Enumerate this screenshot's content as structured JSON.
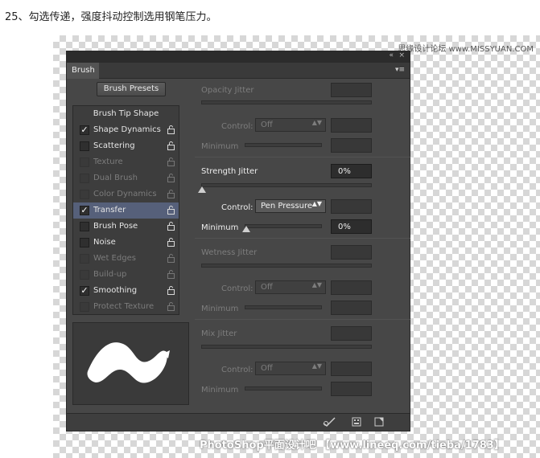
{
  "caption": "25、勾选传递，强度抖动控制选用钢笔压力。",
  "watermark_top": "思缘设计论坛 www.MISSYUAN.COM",
  "watermark_bottom": "PhotoShop平面设计吧 【www.lineeq.com/tieba/1783】",
  "panel": {
    "title_tab": "Brush",
    "collapse_icon": "«",
    "close_icon": "×",
    "menu_icon": "▾≡",
    "presets_button": "Brush Presets",
    "list_header": "Brush Tip Shape",
    "items": [
      {
        "label": "Shape Dynamics",
        "checked": true,
        "enabled": true,
        "selected": false
      },
      {
        "label": "Scattering",
        "checked": false,
        "enabled": true,
        "selected": false
      },
      {
        "label": "Texture",
        "checked": false,
        "enabled": false,
        "selected": false
      },
      {
        "label": "Dual Brush",
        "checked": false,
        "enabled": false,
        "selected": false
      },
      {
        "label": "Color Dynamics",
        "checked": false,
        "enabled": false,
        "selected": false
      },
      {
        "label": "Transfer",
        "checked": true,
        "enabled": true,
        "selected": true
      },
      {
        "label": "Brush Pose",
        "checked": false,
        "enabled": true,
        "selected": false
      },
      {
        "label": "Noise",
        "checked": false,
        "enabled": true,
        "selected": false
      },
      {
        "label": "Wet Edges",
        "checked": false,
        "enabled": false,
        "selected": false
      },
      {
        "label": "Build-up",
        "checked": false,
        "enabled": false,
        "selected": false
      },
      {
        "label": "Smoothing",
        "checked": true,
        "enabled": true,
        "selected": false
      },
      {
        "label": "Protect Texture",
        "checked": false,
        "enabled": false,
        "selected": false
      }
    ],
    "check_glyph": "✓",
    "lock_glyph": "🔓",
    "opacity": {
      "label": "Opacity Jitter",
      "value": "",
      "control_label": "Control:",
      "control_value": "Off",
      "min_label": "Minimum",
      "min_value": ""
    },
    "strength": {
      "label": "Strength Jitter",
      "value": "0%",
      "control_label": "Control:",
      "control_value": "Pen Pressure",
      "min_label": "Minimum",
      "min_value": "0%"
    },
    "wetness": {
      "label": "Wetness Jitter",
      "value": "",
      "control_label": "Control:",
      "control_value": "Off",
      "min_label": "Minimum",
      "min_value": ""
    },
    "mix": {
      "label": "Mix Jitter",
      "value": "",
      "control_label": "Control:",
      "control_value": "Off",
      "min_label": "Minimum",
      "min_value": ""
    },
    "select_arrows": "▲▼"
  },
  "colors": {
    "panel_bg": "#474747",
    "selected_row": "#56607a",
    "disabled_text": "#7c7c7c"
  }
}
